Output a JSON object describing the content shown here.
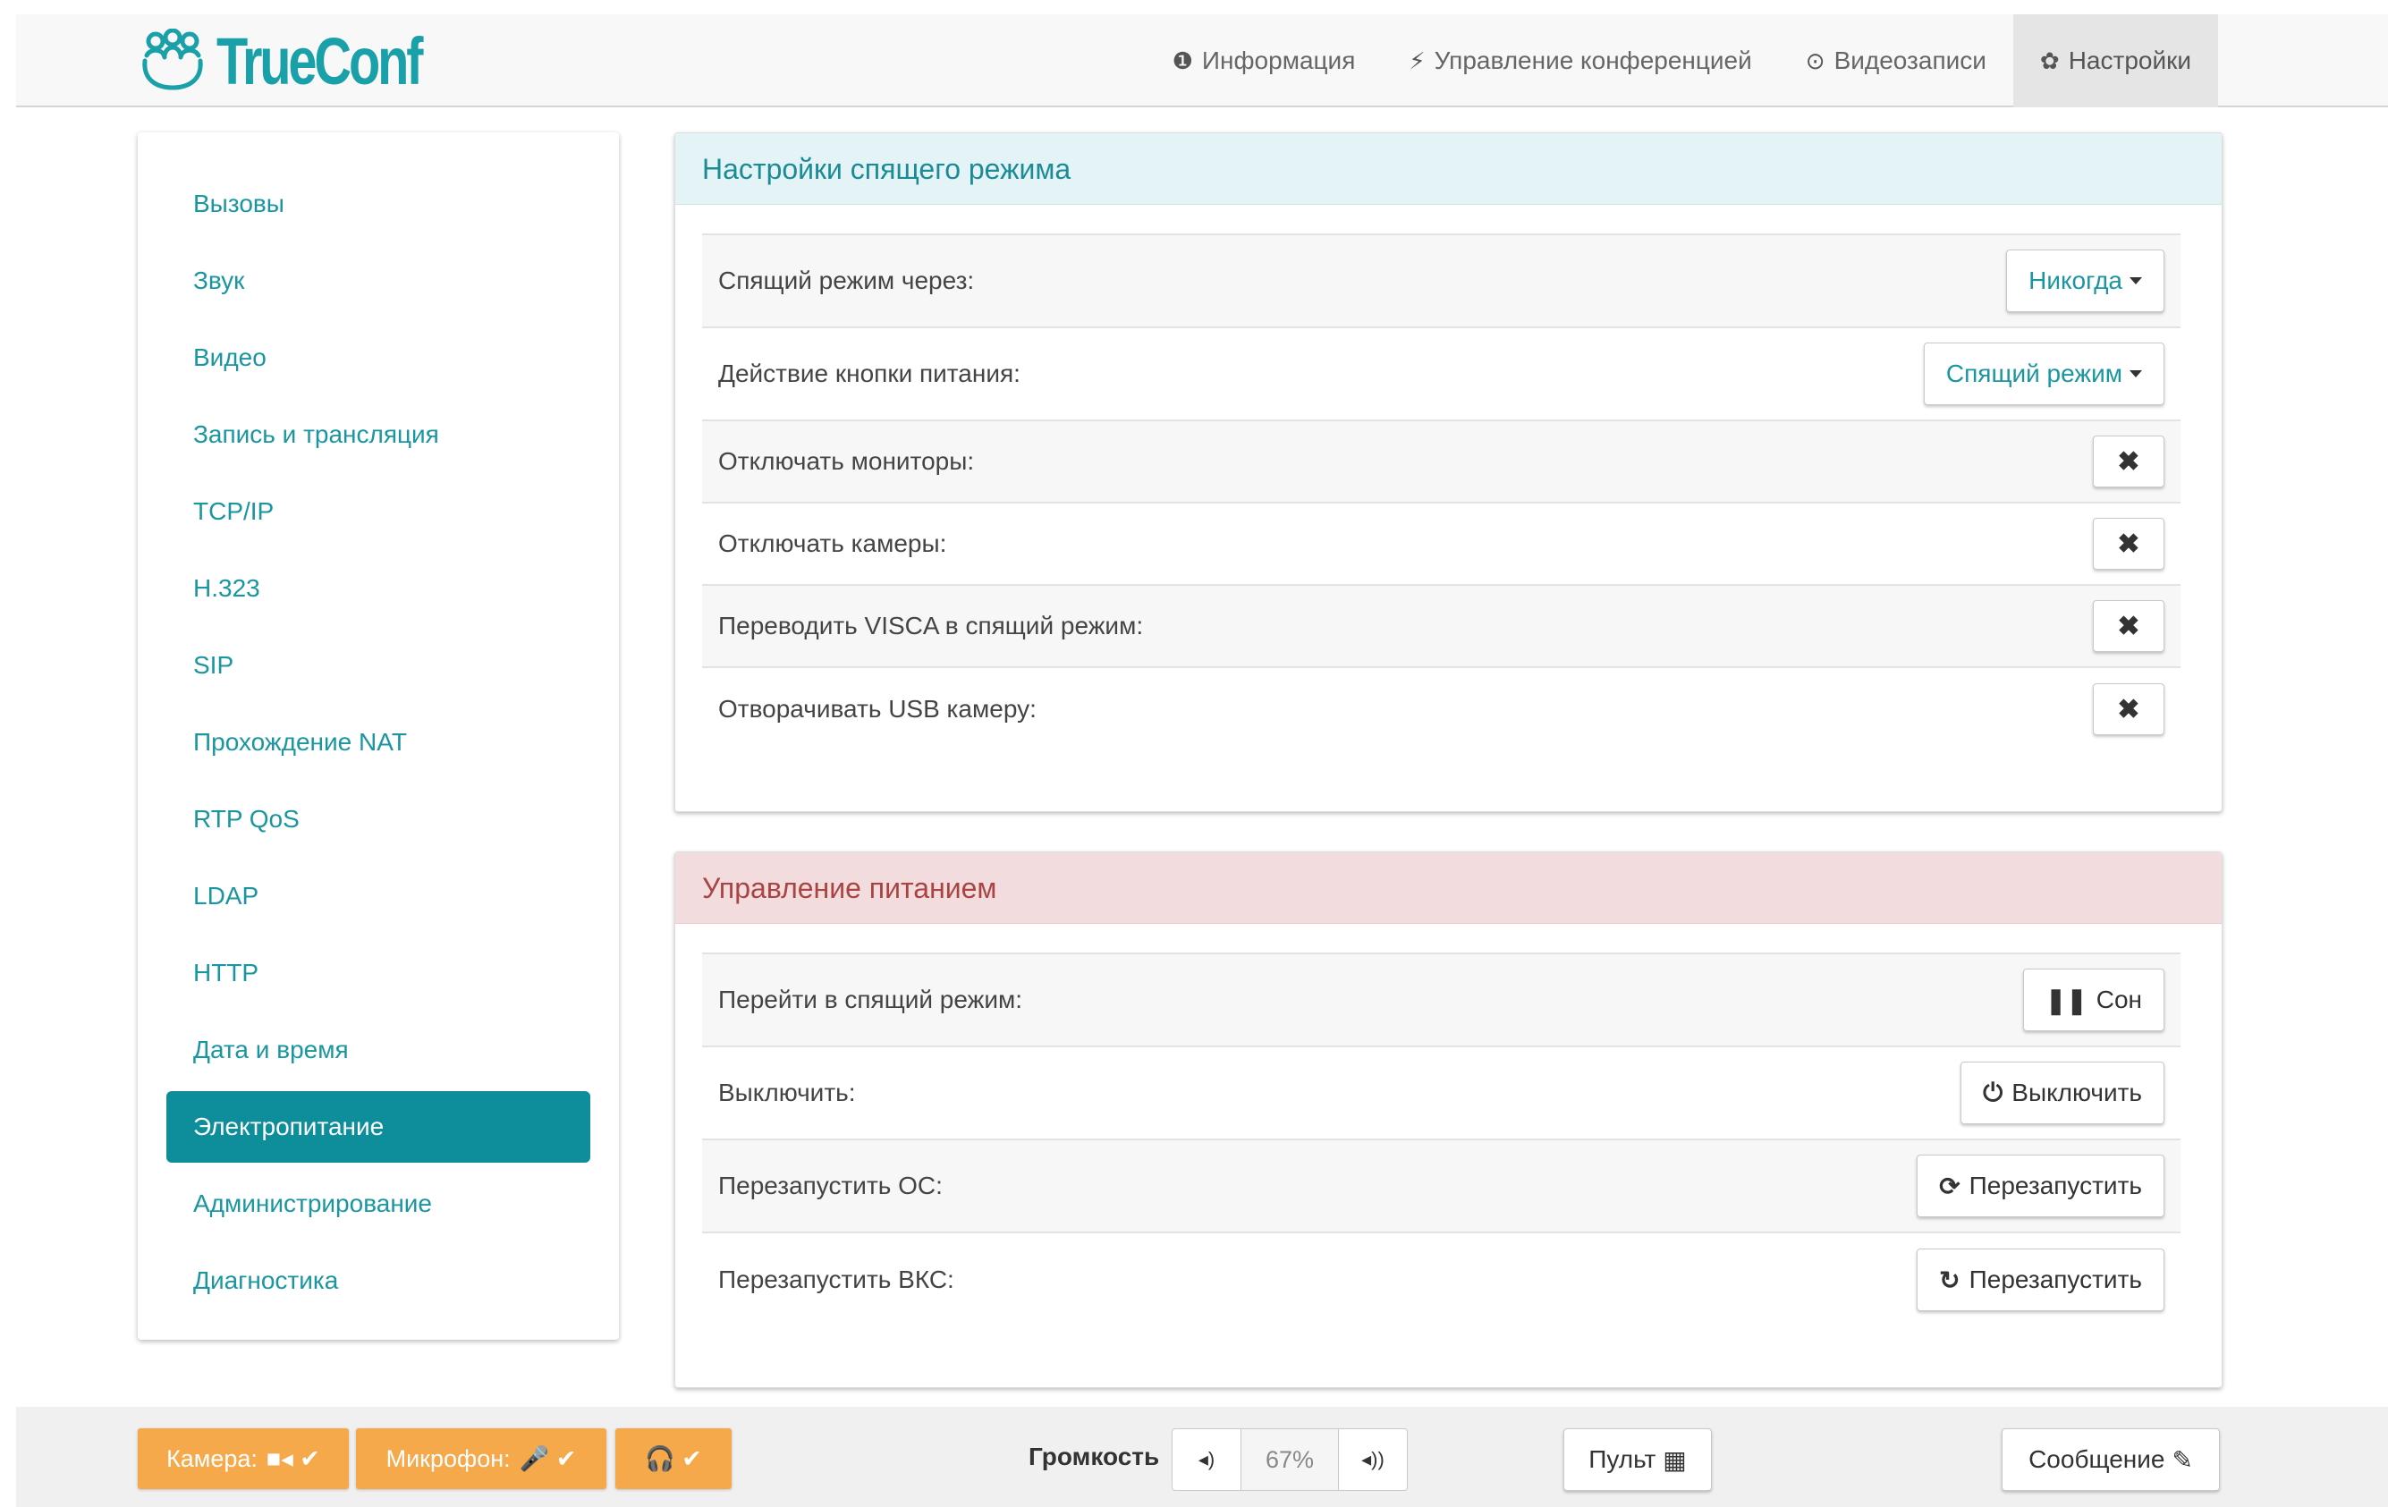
{
  "app": {
    "logo_text": "TrueConf",
    "accent": "#1a96a1"
  },
  "nav": {
    "items": [
      {
        "icon": "info-icon",
        "glyph": "❶",
        "label": "Информация"
      },
      {
        "icon": "bolt-icon",
        "glyph": "⚡",
        "label": "Управление конференцией"
      },
      {
        "icon": "record-icon",
        "glyph": "⊙",
        "label": "Видеозаписи"
      },
      {
        "icon": "gear-icon",
        "glyph": "✿",
        "label": "Настройки"
      }
    ]
  },
  "sidebar": {
    "items": [
      {
        "label": "Вызовы"
      },
      {
        "label": "Звук"
      },
      {
        "label": "Видео"
      },
      {
        "label": "Запись и трансляция"
      },
      {
        "label": "TCP/IP"
      },
      {
        "label": "H.323"
      },
      {
        "label": "SIP"
      },
      {
        "label": "Прохождение NAT"
      },
      {
        "label": "RTP QoS"
      },
      {
        "label": "LDAP"
      },
      {
        "label": "HTTP"
      },
      {
        "label": "Дата и время"
      },
      {
        "label": "Электропитание"
      },
      {
        "label": "Администрирование"
      },
      {
        "label": "Диагностика"
      }
    ],
    "active": "Электропитание"
  },
  "sleep_panel": {
    "title": "Настройки спящего режима",
    "rows": [
      {
        "label": "Спящий режим через:",
        "control": "dropdown",
        "value": "Никогда"
      },
      {
        "label": "Действие кнопки питания:",
        "control": "dropdown",
        "value": "Спящий режим"
      },
      {
        "label": "Отключать мониторы:",
        "control": "toggle",
        "value": "✖"
      },
      {
        "label": "Отключать камеры:",
        "control": "toggle",
        "value": "✖"
      },
      {
        "label": "Переводить VISCA в спящий режим:",
        "control": "toggle",
        "value": "✖"
      },
      {
        "label": "Отворачивать USB камеру:",
        "control": "toggle",
        "value": "✖"
      }
    ]
  },
  "power_panel": {
    "title": "Управление питанием",
    "rows": [
      {
        "label": "Перейти в спящий режим:",
        "button": "Сон",
        "icon": "pause-icon",
        "glyph": "❚❚"
      },
      {
        "label": "Выключить:",
        "button": "Выключить",
        "icon": "power-icon",
        "glyph": "⏻"
      },
      {
        "label": "Перезапустить ОС:",
        "button": "Перезапустить",
        "icon": "refresh-icon",
        "glyph": "⟳"
      },
      {
        "label": "Перезапустить ВКС:",
        "button": "Перезапустить",
        "icon": "restart-icon",
        "glyph": "↻"
      }
    ]
  },
  "footer": {
    "camera_label": "Камера:",
    "camera_icons": "■◂ ✔",
    "mic_label": "Микрофон:",
    "mic_icons": "🎤 ✔",
    "headphones_icons": "🎧 ✔",
    "volume_label": "Громкость",
    "volume_down": "◂)",
    "volume_value": "67%",
    "volume_up": "◂))",
    "remote_label": "Пульт",
    "remote_icon": "▦",
    "message_label": "Сообщение",
    "message_icon": "✎",
    "status_color": "#f5a94a"
  }
}
